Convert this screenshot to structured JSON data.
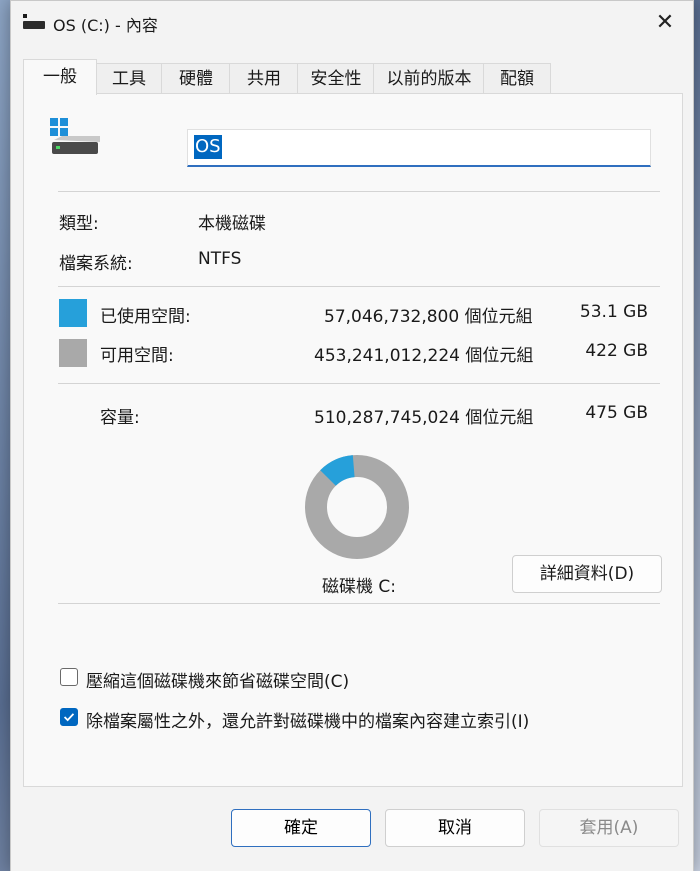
{
  "window": {
    "title": "OS (C:) - 內容",
    "close_glyph": "✕"
  },
  "tabs": [
    {
      "label": "一般",
      "active": true
    },
    {
      "label": "工具"
    },
    {
      "label": "硬體"
    },
    {
      "label": "共用"
    },
    {
      "label": "安全性"
    },
    {
      "label": "以前的版本"
    },
    {
      "label": "配額"
    }
  ],
  "general": {
    "drive_name": "OS",
    "type_label": "類型:",
    "type_value": "本機磁碟",
    "fs_label": "檔案系統:",
    "fs_value": "NTFS",
    "used": {
      "label": "已使用空間:",
      "bytes": "57,046,732,800 個位元組",
      "size": "53.1 GB",
      "color": "#26a0da"
    },
    "free": {
      "label": "可用空間:",
      "bytes": "453,241,012,224 個位元組",
      "size": "422 GB",
      "color": "#a9a9a9"
    },
    "capacity": {
      "label": "容量:",
      "bytes": "510,287,745,024 個位元組",
      "size": "475 GB"
    },
    "used_fraction": 0.112,
    "drive_caption": "磁碟機 C:",
    "details_button": "詳細資料(D)",
    "compress_checkbox": {
      "label": "壓縮這個磁碟機來節省磁碟空間(C)",
      "checked": false
    },
    "index_checkbox": {
      "label": "除檔案屬性之外，還允許對磁碟機中的檔案內容建立索引(I)",
      "checked": true
    }
  },
  "footer": {
    "ok": "確定",
    "cancel": "取消",
    "apply": "套用(A)"
  }
}
